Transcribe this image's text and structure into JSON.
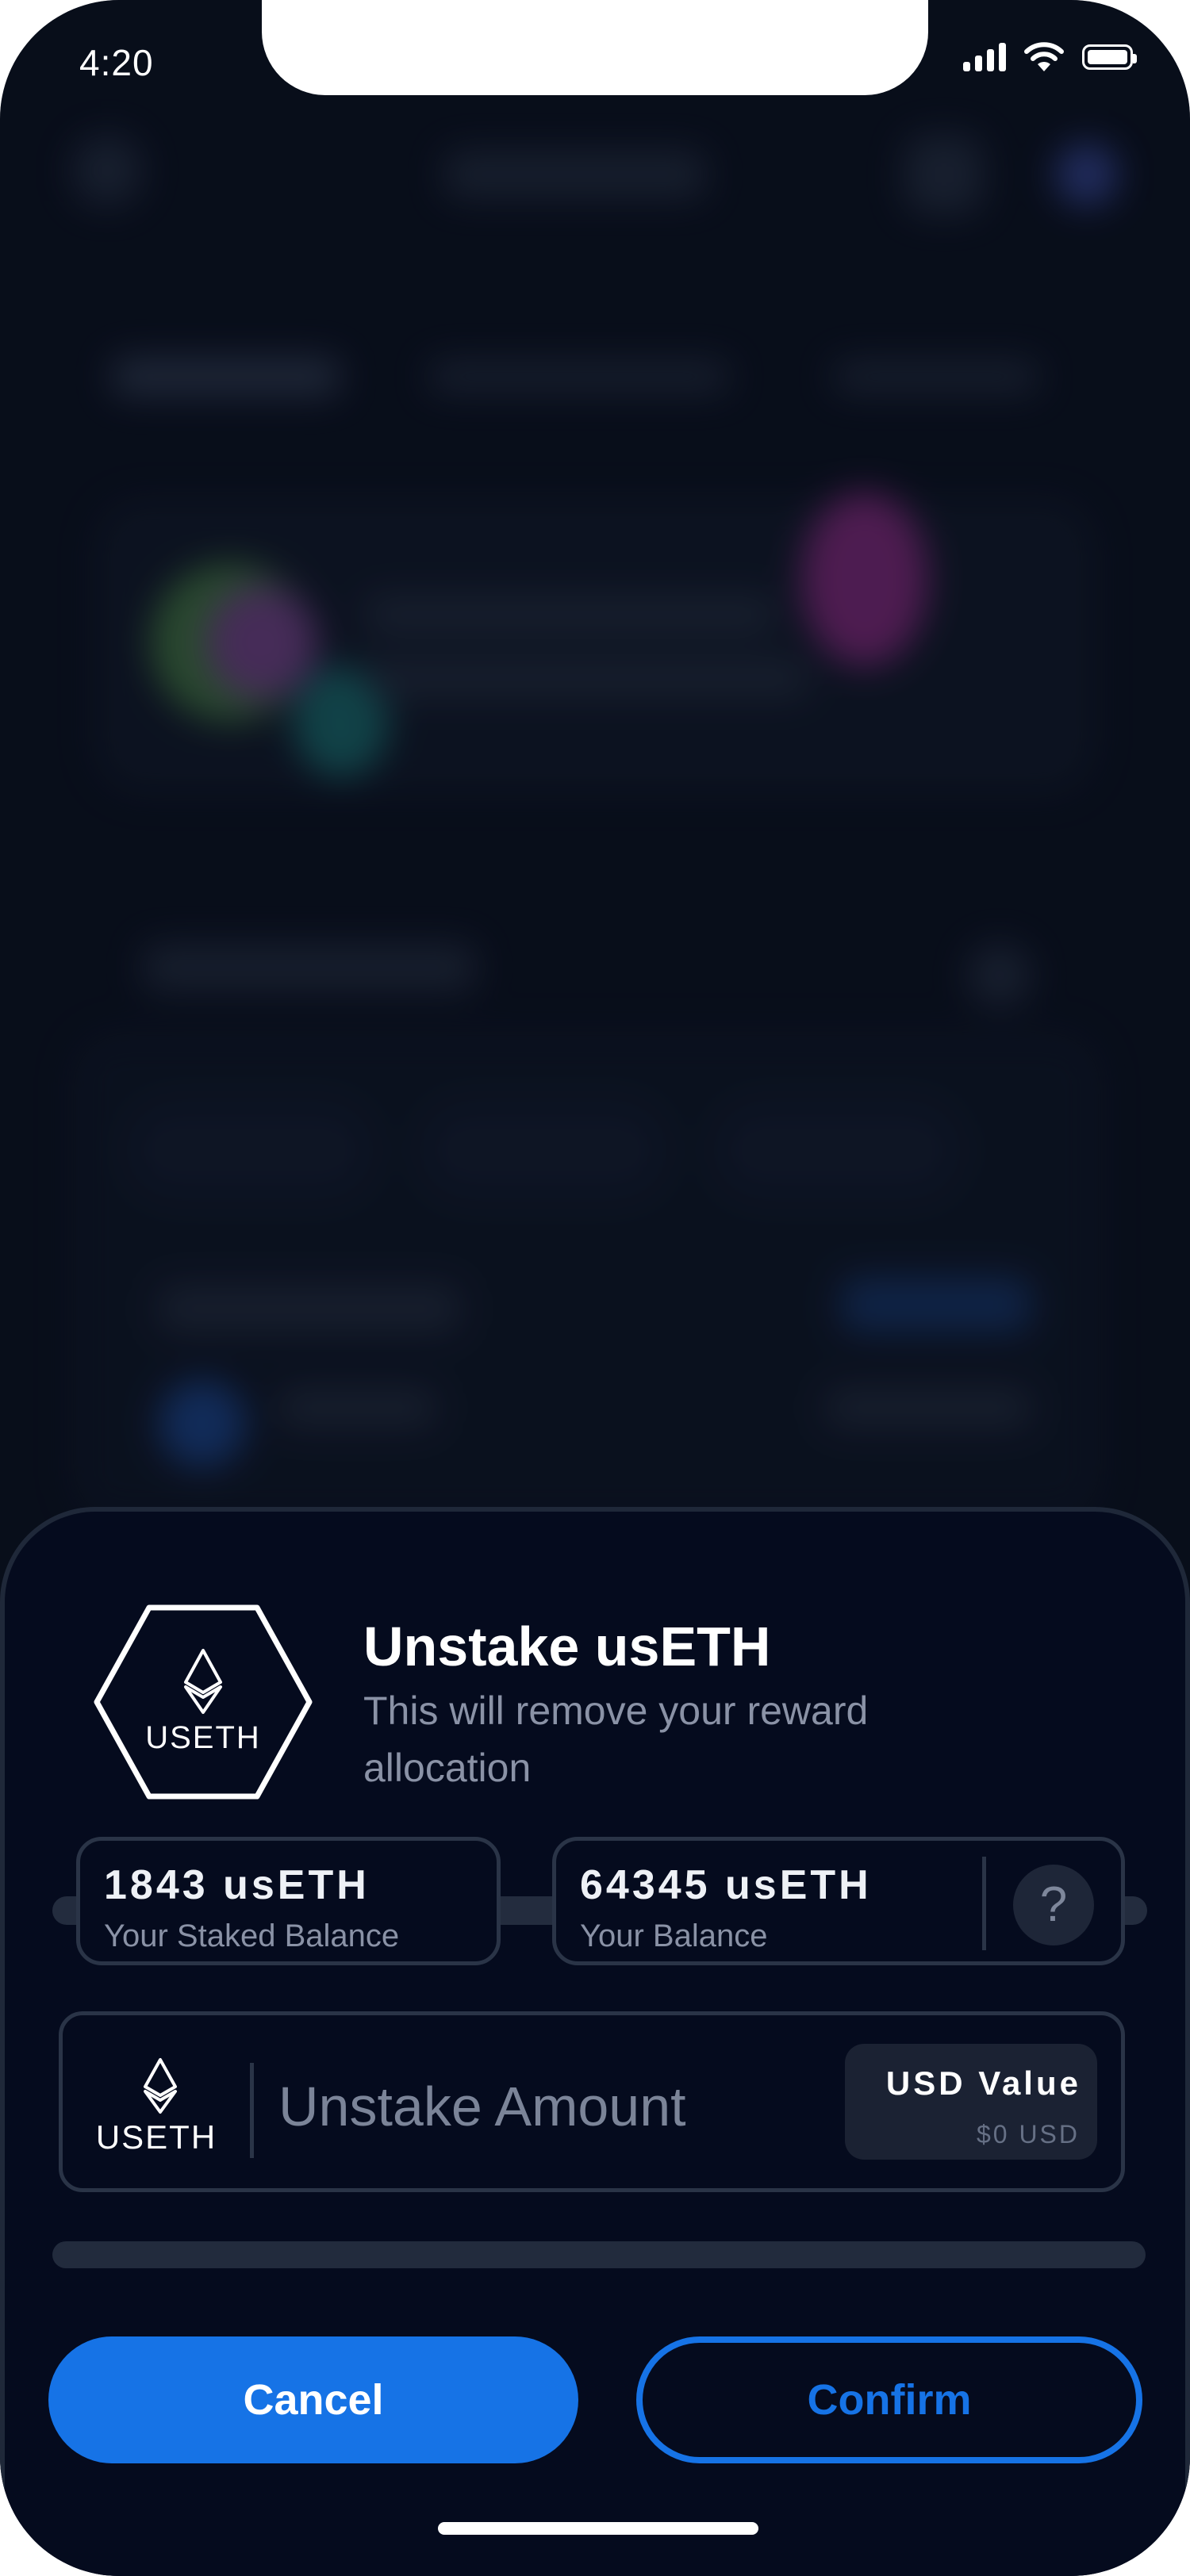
{
  "status_bar": {
    "time": "4:20"
  },
  "sheet": {
    "title": "Unstake usETH",
    "subtitle": "This will remove your reward allocation",
    "token_label": "USETH",
    "staked": {
      "amount": "1843 usETH",
      "label": "Your Staked Balance"
    },
    "balance": {
      "amount": "64345 usETH",
      "label": "Your Balance",
      "help": "?"
    },
    "amount_input": {
      "placeholder": "Unstake Amount",
      "value": ""
    },
    "usd": {
      "label": "USD Value",
      "value": "$0 USD"
    },
    "progress": 0,
    "cancel_label": "Cancel",
    "confirm_label": "Confirm"
  },
  "icons": {
    "token": "ethereum-hexagon-icon",
    "help": "question-icon",
    "wifi": "wifi-icon",
    "signal": "signal-icon",
    "battery": "battery-icon"
  },
  "colors": {
    "accent": "#1673e6",
    "sheet_background": "#050b1e",
    "border": "#2a3447"
  }
}
